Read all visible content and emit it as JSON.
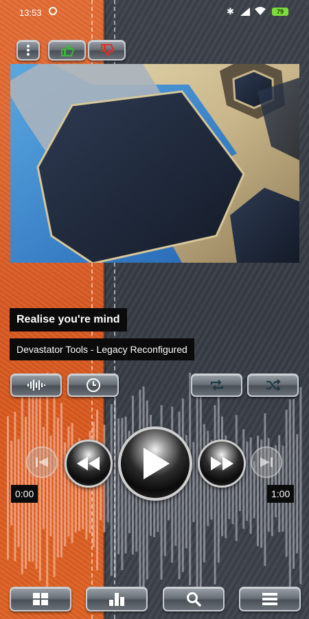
{
  "status_bar": {
    "time": "13:53",
    "battery": "79"
  },
  "track": {
    "title": "Realise you're mind",
    "artist": "Devastator Tools - Legacy Reconfigured"
  },
  "progress": {
    "elapsed": "0:00",
    "total": "1:00",
    "fraction": 0.33
  },
  "top_buttons": [
    "menu-icon",
    "thumbs-up-icon",
    "thumbs-down-icon"
  ],
  "mid_buttons": [
    "equalizer-icon",
    "timer-icon",
    "repeat-icon",
    "shuffle-icon"
  ],
  "transport": [
    "previous-icon",
    "rewind-icon",
    "play-icon",
    "fast-forward-icon",
    "next-icon"
  ],
  "bottom_buttons": [
    "grid-icon",
    "bar-chart-icon",
    "search-icon",
    "list-icon"
  ],
  "colors": {
    "leather_orange": "#e0602a",
    "leather_grey": "#3b4048",
    "like_green": "#2ec12e",
    "dislike_red": "#e0302a"
  }
}
